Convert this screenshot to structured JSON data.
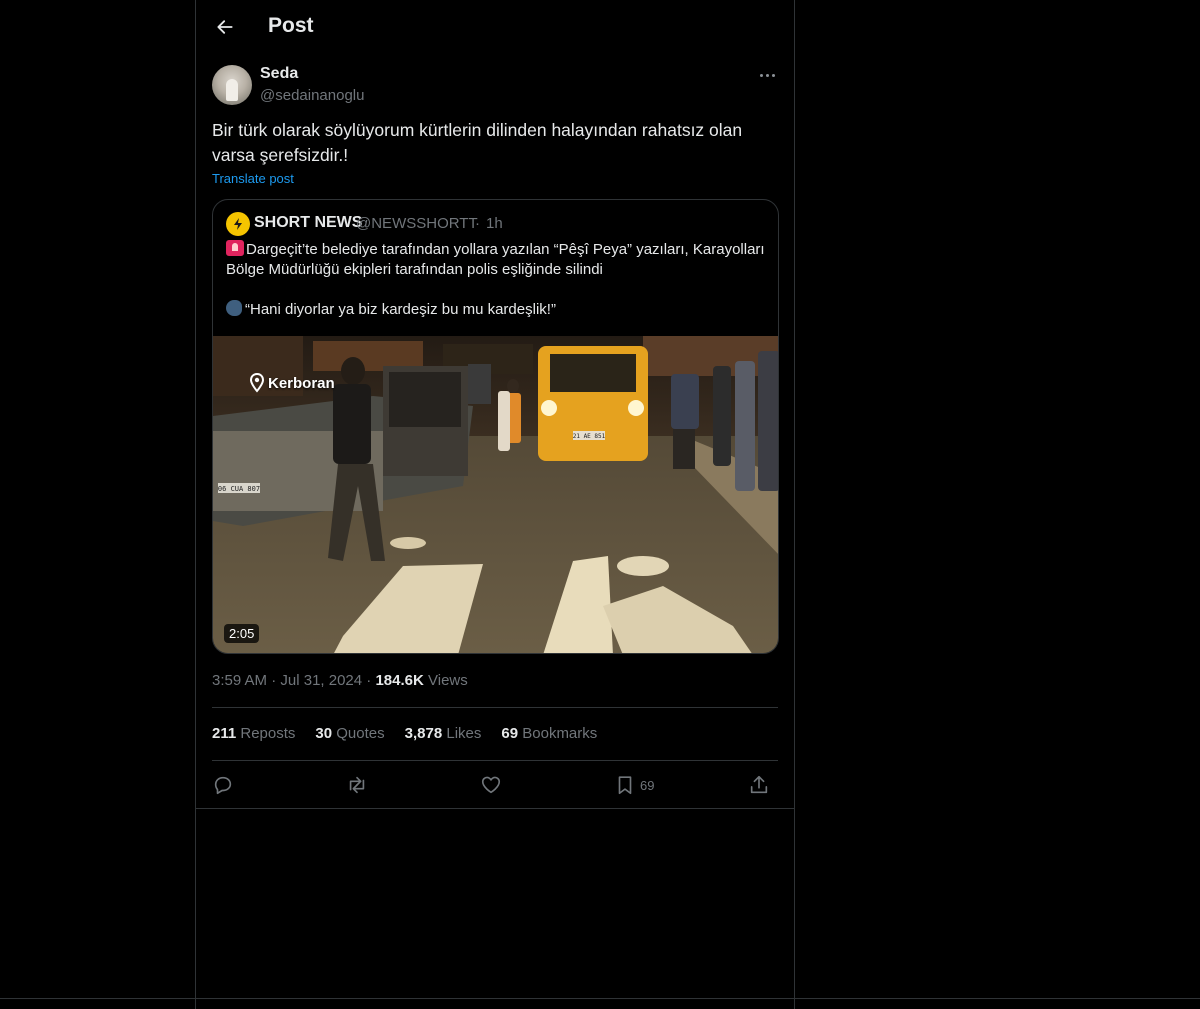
{
  "header": {
    "title": "Post"
  },
  "post": {
    "author_name": "Seda",
    "author_handle": "@sedainanoglu",
    "text": "Bir türk olarak söylüyorum kürtlerin dilinden halayından rahatsız olan varsa şerefsizdir.!",
    "translate_label": "Translate post",
    "time": "3:59 AM",
    "date": "Jul 31, 2024",
    "views_count": "184.6K",
    "views_label": "Views"
  },
  "quote": {
    "name": "SHORT NEWS",
    "handle": "@NEWSSHORTT",
    "time": "1h",
    "text_line1": "Dargeçit’te  belediye tarafından yollara yazılan “Pêşî Peya” yazıları, Karayolları Bölge Müdürlüğü ekipleri tarafından polis eşliğinde silindi",
    "text_line2": "“Hani diyorlar ya biz kardeşiz bu mu kardeşlik!”",
    "video_duration": "2:05",
    "video_watermark": "Kerboran",
    "video_plate_left": "06 CUA 807",
    "video_plate_right": "21 AE 851"
  },
  "stats": {
    "reposts_count": "211",
    "reposts_label": "Reposts",
    "quotes_count": "30",
    "quotes_label": "Quotes",
    "likes_count": "3,878",
    "likes_label": "Likes",
    "bookmarks_count": "69",
    "bookmarks_label": "Bookmarks"
  },
  "actions": {
    "bookmark_count": "69",
    "icons": [
      "reply-icon",
      "repost-icon",
      "like-icon",
      "bookmark-icon",
      "share-icon"
    ]
  },
  "colors": {
    "background": "#000000",
    "text": "#e7e9ea",
    "muted": "#71767b",
    "link": "#1d9bf0",
    "border": "#2f3336"
  }
}
